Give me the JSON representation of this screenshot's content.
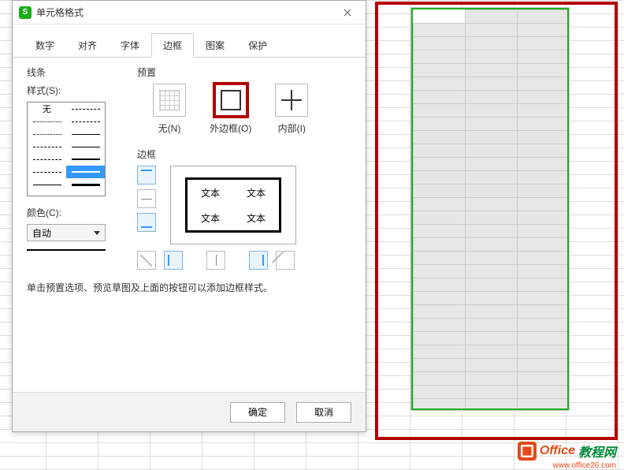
{
  "dialog": {
    "title": "单元格格式",
    "tabs": [
      "数字",
      "对齐",
      "字体",
      "边框",
      "图案",
      "保护"
    ],
    "active_tab": "边框",
    "line": {
      "section": "线条",
      "style_label": "样式(S):",
      "none_label": "无",
      "color_label": "颜色(C):",
      "color_value": "自动"
    },
    "preset": {
      "section": "预置",
      "items": [
        {
          "label": "无(N)"
        },
        {
          "label": "外边框(O)"
        },
        {
          "label": "内部(I)"
        }
      ]
    },
    "border": {
      "section": "边框",
      "preview_text": "文本"
    },
    "hint": "单击预置选项、预览草图及上面的按钮可以添加边框样式。",
    "buttons": {
      "ok": "确定",
      "cancel": "取消"
    }
  },
  "watermark": {
    "brand1": "Office",
    "brand2": "教程网",
    "url": "www.office26.com"
  }
}
